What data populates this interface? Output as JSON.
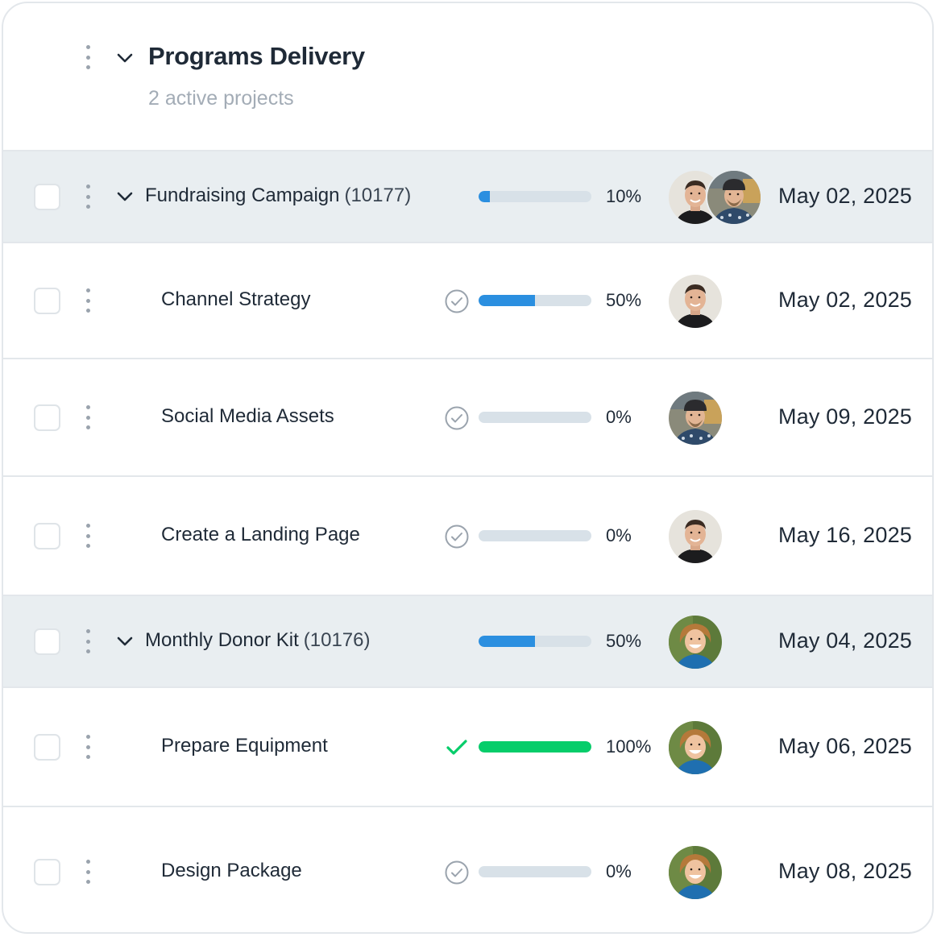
{
  "group": {
    "title": "Programs Delivery",
    "subtitle": "2 active projects"
  },
  "colors": {
    "progress_blue": "#2b8fe0",
    "progress_green": "#06cd6a",
    "track": "#d8e1e8",
    "parent_row_bg": "#e9eef1"
  },
  "rows": [
    {
      "type": "project",
      "name": "Fundraising Campaign",
      "code": "(10177)",
      "progress": 0.1,
      "percent_label": "10%",
      "assignees": [
        "avatar-man-1",
        "avatar-man-2"
      ],
      "date": "May 02, 2025"
    },
    {
      "type": "task",
      "name": "Channel Strategy",
      "status_icon": "check-circle-icon",
      "progress": 0.5,
      "percent_label": "50%",
      "assignees": [
        "avatar-man-1"
      ],
      "date": "May 02, 2025"
    },
    {
      "type": "task",
      "name": "Social Media Assets",
      "status_icon": "check-circle-icon",
      "progress": 0,
      "percent_label": "0%",
      "assignees": [
        "avatar-man-2"
      ],
      "date": "May 09, 2025"
    },
    {
      "type": "task",
      "name": "Create a Landing Page",
      "status_icon": "check-circle-icon",
      "progress": 0,
      "percent_label": "0%",
      "assignees": [
        "avatar-man-1"
      ],
      "date": "May 16, 2025"
    },
    {
      "type": "project",
      "name": "Monthly Donor Kit",
      "code": "(10176)",
      "progress": 0.5,
      "percent_label": "50%",
      "assignees": [
        "avatar-woman"
      ],
      "date": "May 04, 2025"
    },
    {
      "type": "task",
      "name": "Prepare Equipment",
      "status_icon": "checkmark-icon",
      "progress": 1.0,
      "percent_label": "100%",
      "assignees": [
        "avatar-woman"
      ],
      "date": "May 06, 2025"
    },
    {
      "type": "task",
      "name": "Design Package",
      "status_icon": "check-circle-icon",
      "progress": 0,
      "percent_label": "0%",
      "assignees": [
        "avatar-woman"
      ],
      "date": "May 08, 2025"
    }
  ]
}
